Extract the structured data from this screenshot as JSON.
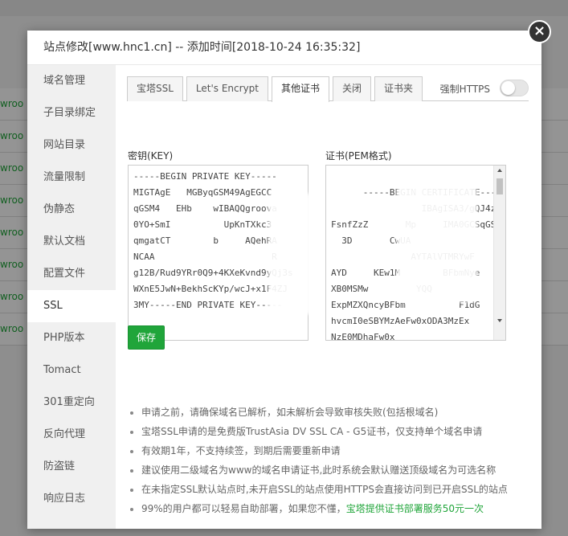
{
  "modal": {
    "title": "站点修改[www.hnc1.cn] -- 添加时间[2018-10-24 16:35:32]",
    "close_label": "×"
  },
  "background": {
    "row_text": "wroo"
  },
  "sidebar": {
    "items": [
      {
        "label": "域名管理"
      },
      {
        "label": "子目录绑定"
      },
      {
        "label": "网站目录"
      },
      {
        "label": "流量限制"
      },
      {
        "label": "伪静态"
      },
      {
        "label": "默认文档"
      },
      {
        "label": "配置文件"
      },
      {
        "label": "SSL"
      },
      {
        "label": "PHP版本"
      },
      {
        "label": "Tomact"
      },
      {
        "label": "301重定向"
      },
      {
        "label": "反向代理"
      },
      {
        "label": "防盗链"
      },
      {
        "label": "响应日志"
      }
    ],
    "active_index": 7
  },
  "tabs": [
    {
      "label": "宝塔SSL"
    },
    {
      "label": "Let's Encrypt"
    },
    {
      "label": "其他证书"
    },
    {
      "label": "关闭"
    },
    {
      "label": "证书夹"
    }
  ],
  "active_tab": 2,
  "force_https": {
    "label": "强制HTTPS",
    "enabled": false
  },
  "key_field": {
    "label": "密钥(KEY)",
    "value": "-----BEGIN PRIVATE KEY-----\nMIGTAgE   MGByqGSM49AgEGCC\nqGSM4   EHb    wIBAQQgroova\n0YO+SmI          UpKnTXkc3\nqmgatCT        b     AQehRA\nNCAA                      R\ng12B/Rud9YRr0Q9+4KXeKvnd9yQj3s\nWXnE5JwN+BekhScKYp/wcJ+x1F4ZJ\n3MY-----END PRIVATE KEY-----"
  },
  "cert_field": {
    "label": "证书(PEM格式)",
    "value": "-----BEGIN CERTIFICATE-----\n                 IBAgISA3/gQJ4z\nFsnfZzZ       Mp     IMA0GCSqGSI\n  3D       CwUA\n               AYTAlVTMRYwF\nAYD     KEw1M        BFbmNye\nXB0MSMw         YQQ\nExpMZXQncyBFbm          F1dG\nhvcmI0eSBYMzAeFw0xODA3MzEx\nNzE0MDhaFw0x"
  },
  "save_button": {
    "label": "保存"
  },
  "notes": [
    {
      "text": "申请之前，请确保域名已解析，如未解析会导致审核失败(包括根域名)"
    },
    {
      "text": "宝塔SSL申请的是免费版TrustAsia DV SSL CA - G5证书，仅支持单个域名申请"
    },
    {
      "text": "有效期1年，不支持续签，到期后需要重新申请"
    },
    {
      "text": "建议使用二级域名为www的域名申请证书,此时系统会默认赠送顶级域名为可选名称"
    },
    {
      "text": "在未指定SSL默认站点时,未开启SSL的站点使用HTTPS会直接访问到已开启SSL的站点"
    },
    {
      "text": "99%的用户都可以轻易自助部署，如果您不懂，",
      "link": "宝塔提供证书部署服务50元一次"
    }
  ],
  "colors": {
    "accent": "#20a53a",
    "sidebar_bg": "#f0f0f0"
  }
}
